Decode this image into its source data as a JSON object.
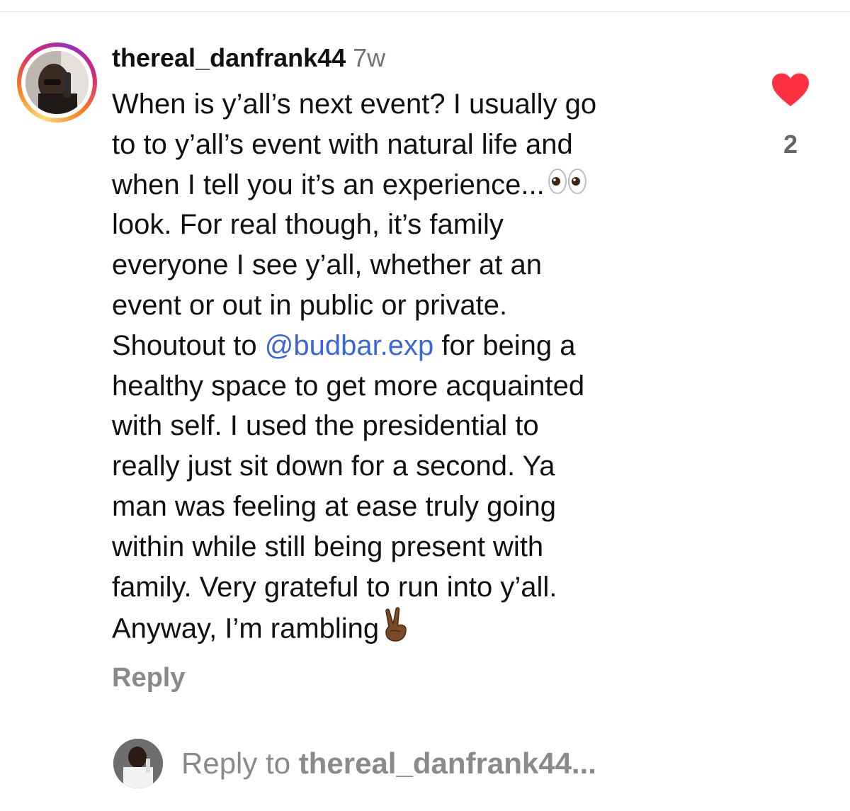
{
  "comment": {
    "username": "thereal_danfrank44",
    "timestamp": "7w",
    "lines": [
      "When is y’all’s next event? I usually go",
      "to to y’all’s event with natural life and",
      "when I tell you it’s an experience...",
      "look. For real though, it’s family",
      "everyone I see y’all, whether at an",
      "event or out in public or private.",
      "Shoutout to ",
      "healthy space to get more acquainted",
      "with self. I used the presidential to",
      "really just sit down for a second. Ya",
      "man was feeling at ease truly going",
      "within while still being present with",
      "family. Very grateful to run into y’all.",
      "Anyway, I’m rambling"
    ],
    "mention": "@budbar.exp",
    "mention_suffix": " for being a",
    "eyes_emoji_icon": "eyes-emoji-icon",
    "peace_emoji_icon": "victory-hand-emoji-icon",
    "like_count": "2",
    "like_color": "#ff3040",
    "reply_label": "Reply",
    "mention_color": "#3a67d8"
  },
  "reply_bar": {
    "prefix": "Reply to ",
    "target": "thereal_danfrank44..."
  }
}
